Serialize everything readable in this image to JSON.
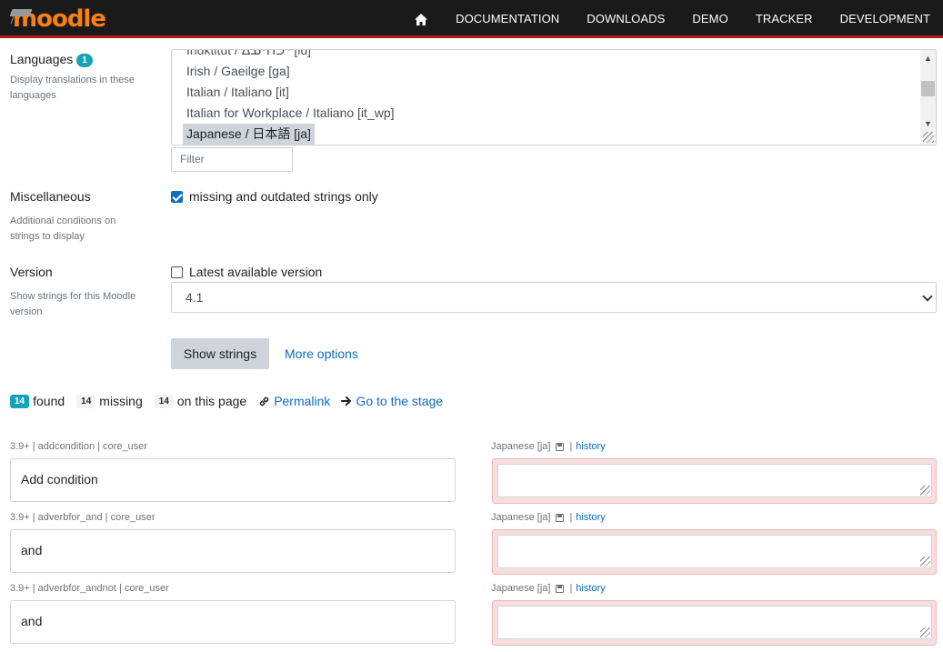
{
  "header": {
    "logo": "moodle",
    "nav": [
      "DOCUMENTATION",
      "DOWNLOADS",
      "DEMO",
      "TRACKER",
      "DEVELOPMENT"
    ]
  },
  "languages": {
    "label": "Languages",
    "badge": "1",
    "help": "Display translations in these languages",
    "options": [
      "Inuktitut / ᐃᓄᒃᑎᑐᑦ [iu]",
      "Irish / Gaeilge [ga]",
      "Italian / Italiano [it]",
      "Italian for Workplace / Italiano [it_wp]",
      "Japanese / 日本語 [ja]"
    ],
    "filter_placeholder": "Filter"
  },
  "misc": {
    "label": "Miscellaneous",
    "help": "Additional conditions on strings to display",
    "checkbox_label": "missing and outdated strings only",
    "checked": true
  },
  "version": {
    "label": "Version",
    "help": "Show strings for this Moodle version",
    "checkbox_label": "Latest available version",
    "checked": false,
    "selected": "4.1"
  },
  "actions": {
    "show_strings": "Show strings",
    "more_options": "More options"
  },
  "stats": {
    "found_count": "14",
    "found_label": "found",
    "missing_count": "14",
    "missing_label": "missing",
    "page_count": "14",
    "page_label": "on this page",
    "permalink": "Permalink",
    "stage": "Go to the stage"
  },
  "strings": [
    {
      "meta": "3.9+ | addcondition | core_user",
      "original": "Add condition",
      "target": "Japanese [ja]",
      "history": "history"
    },
    {
      "meta": "3.9+ | adverbfor_and | core_user",
      "original": "and",
      "target": "Japanese [ja]",
      "history": "history"
    },
    {
      "meta": "3.9+ | adverbfor_andnot | core_user",
      "original": "and",
      "target": "Japanese [ja]",
      "history": "history"
    }
  ]
}
